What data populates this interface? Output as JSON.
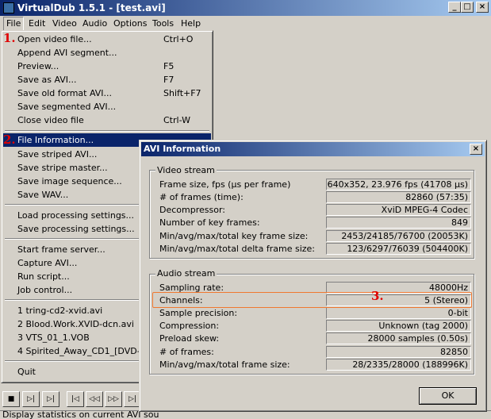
{
  "window": {
    "title": "VirtualDub 1.5.1 - [test.avi]",
    "buttons": [
      "_",
      "□",
      "×"
    ]
  },
  "menubar": [
    "File",
    "Edit",
    "Video",
    "Audio",
    "Options",
    "Tools",
    "Help"
  ],
  "file_menu": {
    "items": [
      {
        "label": "Open video file...",
        "accel": "Ctrl+O"
      },
      {
        "label": "Append AVI segment...",
        "accel": ""
      },
      {
        "label": "Preview...",
        "accel": "F5"
      },
      {
        "label": "Save as AVI...",
        "accel": "F7"
      },
      {
        "label": "Save old format AVI...",
        "accel": "Shift+F7"
      },
      {
        "label": "Save segmented AVI...",
        "accel": ""
      },
      {
        "label": "Close video file",
        "accel": "Ctrl-W"
      },
      {
        "label": "File Information...",
        "accel": ""
      },
      {
        "label": "Save striped AVI...",
        "accel": ""
      },
      {
        "label": "Save stripe master...",
        "accel": ""
      },
      {
        "label": "Save image sequence...",
        "accel": ""
      },
      {
        "label": "Save WAV...",
        "accel": ""
      },
      {
        "label": "Load processing settings...",
        "accel": ""
      },
      {
        "label": "Save processing settings...",
        "accel": ""
      },
      {
        "label": "Start frame server...",
        "accel": ""
      },
      {
        "label": "Capture AVI...",
        "accel": ""
      },
      {
        "label": "Run script...",
        "accel": ""
      },
      {
        "label": "Job control...",
        "accel": ""
      },
      {
        "label": "1 tring-cd2-xvid.avi",
        "accel": ""
      },
      {
        "label": "2 Blood.Work.XVID-dcn.avi",
        "accel": ""
      },
      {
        "label": "3 VTS_01_1.VOB",
        "accel": ""
      },
      {
        "label": "4 Spirited_Away_CD1_[DVD-Rip",
        "accel": ""
      },
      {
        "label": "Quit",
        "accel": ""
      }
    ]
  },
  "annotations": [
    "1.",
    "2.",
    "3."
  ],
  "toolbar": [
    "■",
    "▷|",
    "▷|",
    "|◁",
    "◁◁",
    "▷▷",
    "▷|"
  ],
  "status_text": "Display statistics on current AVI sou",
  "dialog": {
    "title": "AVI Information",
    "close": "×",
    "video_group": "Video stream",
    "video_rows": [
      {
        "label": "Frame size, fps (µs per frame)",
        "value": "640x352, 23.976 fps (41708 µs)"
      },
      {
        "label": "# of frames (time):",
        "value": "82860 (57:35)"
      },
      {
        "label": "Decompressor:",
        "value": "XviD MPEG-4 Codec"
      },
      {
        "label": "Number of key frames:",
        "value": "849"
      },
      {
        "label": "Min/avg/max/total key frame size:",
        "value": "2453/24185/76700 (20053K)"
      },
      {
        "label": "Min/avg/max/total delta frame size:",
        "value": "123/6297/76039 (504400K)"
      }
    ],
    "audio_group": "Audio stream",
    "audio_rows": [
      {
        "label": "Sampling rate:",
        "value": "48000Hz"
      },
      {
        "label": "Channels:",
        "value": "5 (Stereo)"
      },
      {
        "label": "Sample precision:",
        "value": "0-bit"
      },
      {
        "label": "Compression:",
        "value": "Unknown (tag 2000)"
      },
      {
        "label": "Preload skew:",
        "value": "28000 samples (0.50s)"
      },
      {
        "label": "# of frames:",
        "value": "82850"
      },
      {
        "label": "Min/avg/max/total frame size:",
        "value": "28/2335/28000 (188996K)"
      }
    ],
    "ok_label": "OK"
  }
}
